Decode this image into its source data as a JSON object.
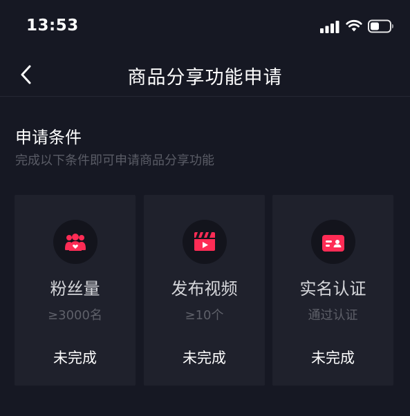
{
  "status_bar": {
    "time": "13:53",
    "icons": [
      "signal-icon",
      "wifi-icon",
      "battery-icon"
    ],
    "battery_level": 0.4
  },
  "nav": {
    "back_icon": "chevron-left-icon",
    "title": "商品分享功能申请"
  },
  "section": {
    "title": "申请条件",
    "subtitle": "完成以下条件即可申请商品分享功能"
  },
  "conditions": [
    {
      "icon": "fans-icon",
      "title": "粉丝量",
      "requirement": "≥3000名",
      "status": "未完成"
    },
    {
      "icon": "video-clapper-icon",
      "title": "发布视频",
      "requirement": "≥10个",
      "status": "未完成"
    },
    {
      "icon": "id-card-icon",
      "title": "实名认证",
      "requirement": "通过认证",
      "status": "未完成"
    }
  ],
  "colors": {
    "background": "#161823",
    "card": "#1f212c",
    "accent": "#fe2c55",
    "muted_text": "#5e6069"
  }
}
